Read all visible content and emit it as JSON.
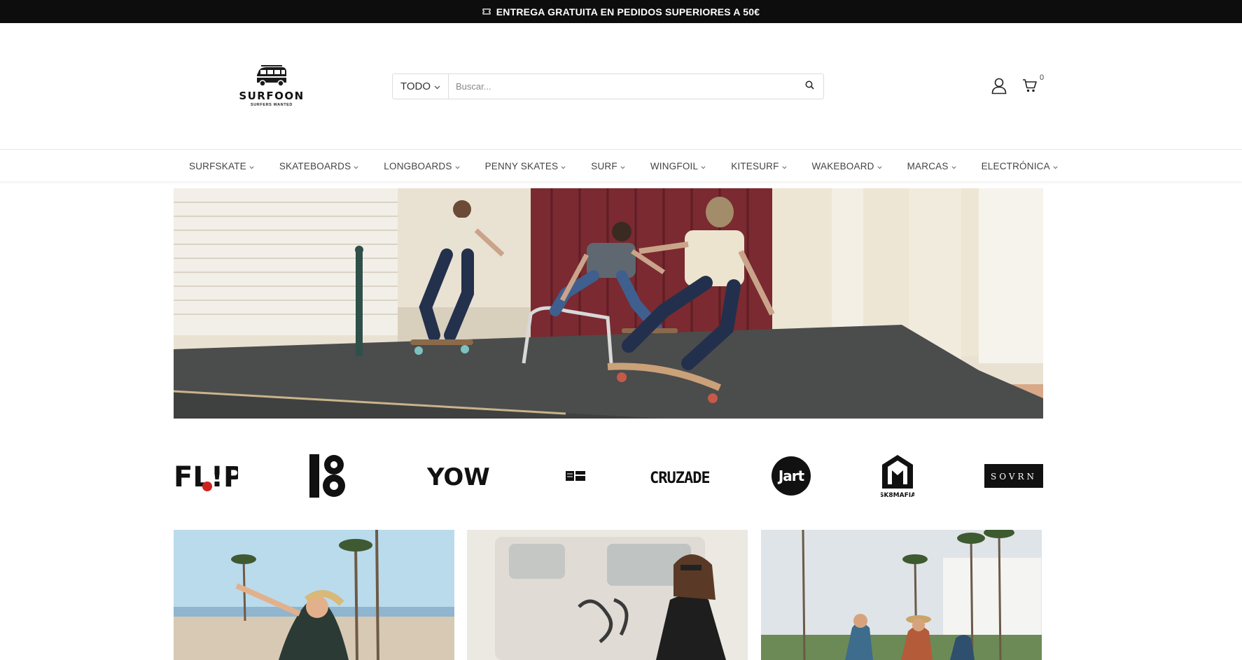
{
  "announcement": {
    "icon": "ticket-icon",
    "text": "ENTREGA GRATUITA EN PEDIDOS SUPERIORES A 50€"
  },
  "logo": {
    "name": "SURFOON",
    "tagline": "SURFERS WANTED",
    "icon": "van-icon"
  },
  "search": {
    "category": "TODO",
    "placeholder": "Buscar...",
    "value": "",
    "icon": "search-icon"
  },
  "header_icons": {
    "account_icon": "user-icon",
    "cart_icon": "cart-icon",
    "cart_count": "0"
  },
  "nav": {
    "items": [
      {
        "label": "SURFSKATE"
      },
      {
        "label": "SKATEBOARDS"
      },
      {
        "label": "LONGBOARDS"
      },
      {
        "label": "PENNY SKATES"
      },
      {
        "label": "SURF"
      },
      {
        "label": "WINGFOIL"
      },
      {
        "label": "KITESURF"
      },
      {
        "label": "WAKEBOARD"
      },
      {
        "label": "MARCAS"
      },
      {
        "label": "ELECTRÓNICA"
      }
    ]
  },
  "hero": {
    "image": "three skaters carving surfskates on a street in front of a red garage door"
  },
  "brands": [
    {
      "name": "FLIP",
      "logo": "flip-logo",
      "wordmark": "FL!P"
    },
    {
      "name": "Globe",
      "logo": "globe-logo",
      "wordmark": ""
    },
    {
      "name": "YOW",
      "logo": "yow-logo",
      "wordmark": "YOW"
    },
    {
      "name": "Long Island",
      "logo": "long-island-logo",
      "wordmark": ""
    },
    {
      "name": "Cruzade",
      "logo": "cruzade-logo",
      "wordmark": "CRUZADE"
    },
    {
      "name": "Jart",
      "logo": "jart-logo",
      "wordmark": "Jart"
    },
    {
      "name": "SK8MAFIA",
      "logo": "sk8mafia-logo",
      "wordmark": "SK8MAFIA"
    },
    {
      "name": "SOVRN",
      "logo": "sovrn-logo",
      "wordmark": "SOVRN"
    }
  ],
  "tiles": [
    {
      "image": "girl surfskating on a beach promenade with palm trees"
    },
    {
      "image": "woman sitting in front of a white van with graffiti"
    },
    {
      "image": "people riding bikes on a street lined with palm trees"
    }
  ],
  "colors": {
    "announce_bg": "#0d0d0d",
    "text": "#444444",
    "border": "#dcdcdc"
  }
}
